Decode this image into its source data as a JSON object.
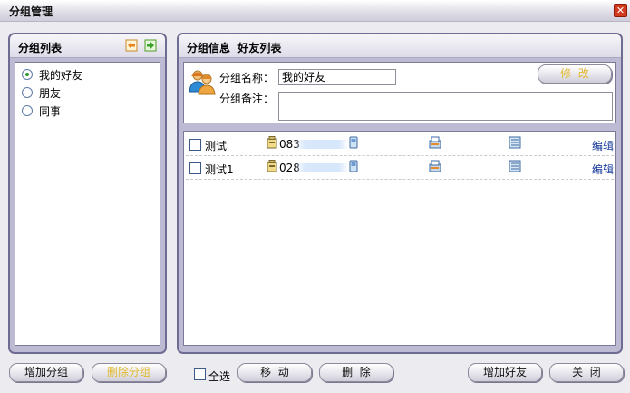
{
  "window": {
    "title": "分组管理",
    "close_label": "✕"
  },
  "left_panel": {
    "title": "分组列表",
    "groups": [
      {
        "label": "我的好友",
        "selected": true
      },
      {
        "label": "朋友",
        "selected": false
      },
      {
        "label": "同事",
        "selected": false
      }
    ]
  },
  "right_panel": {
    "title": "分组信息  好友列表",
    "name_label": "分组名称：",
    "name_value": "我的好友",
    "note_label": "分组备注：",
    "note_value": "",
    "modify_button": "修  改",
    "friends": [
      {
        "name": "测试",
        "phone": "083",
        "edit": "编辑"
      },
      {
        "name": "测试1",
        "phone": "028",
        "edit": "编辑"
      }
    ]
  },
  "footer": {
    "add_group": "增加分组",
    "delete_group": "删除分组",
    "select_all": "全选",
    "move": "移  动",
    "delete": "删  除",
    "add_friend": "增加好友",
    "close": "关  闭"
  },
  "colors": {
    "disabled_text": "#e0ba2e",
    "edit_link": "#1a3d9c",
    "panel_border": "#6f6c93"
  }
}
